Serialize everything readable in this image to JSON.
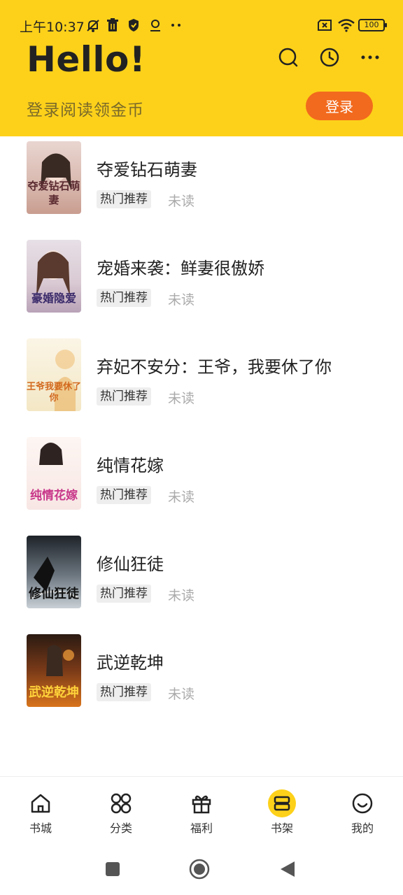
{
  "status": {
    "time": "上午10:37",
    "battery": "100",
    "left_icons": [
      "mute-icon",
      "trash-icon",
      "shield-icon",
      "location-icon",
      "more-dots-icon"
    ],
    "right_icons": [
      "sim-off-icon",
      "wifi-icon",
      "battery-icon"
    ]
  },
  "header": {
    "greeting": "Hello!",
    "subtitle": "登录阅读领金币",
    "login_label": "登录",
    "actions": [
      "search-icon",
      "history-icon",
      "more-icon"
    ],
    "background": "#fdd11a",
    "login_color": "#f26a1d"
  },
  "books": [
    {
      "title": "夺爱钻石萌妻",
      "tag": "热门推荐",
      "status": "未读",
      "cover_text": "夺爱钻石萌妻"
    },
    {
      "title": "宠婚来袭：鲜妻很傲娇",
      "tag": "热门推荐",
      "status": "未读",
      "cover_text": "豪婚隐爱"
    },
    {
      "title": "弃妃不安分：王爷，我要休了你",
      "tag": "热门推荐",
      "status": "未读",
      "cover_text": "王爷我要休了你"
    },
    {
      "title": "纯情花嫁",
      "tag": "热门推荐",
      "status": "未读",
      "cover_text": "纯情花嫁"
    },
    {
      "title": "修仙狂徒",
      "tag": "热门推荐",
      "status": "未读",
      "cover_text": "修仙狂徒"
    },
    {
      "title": "武逆乾坤",
      "tag": "热门推荐",
      "status": "未读",
      "cover_text": "武逆乾坤"
    }
  ],
  "nav": [
    {
      "label": "书城",
      "icon": "home-icon"
    },
    {
      "label": "分类",
      "icon": "category-icon"
    },
    {
      "label": "福利",
      "icon": "gift-icon"
    },
    {
      "label": "书架",
      "icon": "bookshelf-icon",
      "active": true
    },
    {
      "label": "我的",
      "icon": "smile-icon"
    }
  ],
  "system_nav": [
    "recent-apps-icon",
    "home-button-icon",
    "back-icon"
  ]
}
